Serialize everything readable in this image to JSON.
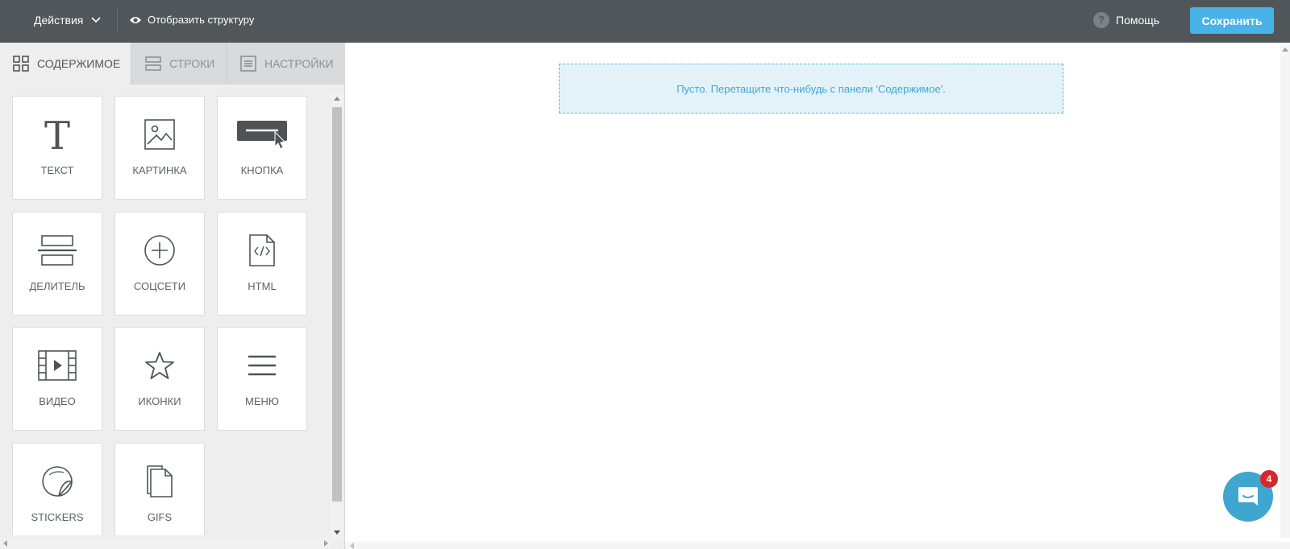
{
  "topbar": {
    "actions_label": "Действия",
    "structure_label": "Отобразить структуру",
    "help_label": "Помощь",
    "save_label": "Сохранить"
  },
  "sidepanel": {
    "tabs": [
      {
        "label": "СОДЕРЖИМОЕ",
        "icon": "grid-icon",
        "active": true
      },
      {
        "label": "СТРОКИ",
        "icon": "rows-icon",
        "active": false
      },
      {
        "label": "НАСТРОЙКИ",
        "icon": "settings-doc-icon",
        "active": false
      }
    ],
    "blocks": [
      {
        "label": "ТЕКСТ",
        "icon": "text-icon"
      },
      {
        "label": "КАРТИНКА",
        "icon": "image-icon"
      },
      {
        "label": "КНОПКА",
        "icon": "button-icon"
      },
      {
        "label": "ДЕЛИТЕЛЬ",
        "icon": "divider-icon"
      },
      {
        "label": "СОЦСЕТИ",
        "icon": "social-plus-icon"
      },
      {
        "label": "HTML",
        "icon": "html-file-icon"
      },
      {
        "label": "ВИДЕО",
        "icon": "video-icon"
      },
      {
        "label": "ИКОНКИ",
        "icon": "star-icon"
      },
      {
        "label": "МЕНЮ",
        "icon": "menu-icon"
      },
      {
        "label": "STICKERS",
        "icon": "sticker-icon"
      },
      {
        "label": "GIFS",
        "icon": "gif-file-icon"
      }
    ]
  },
  "canvas": {
    "empty_message": "Пусто. Перетащите что-нибудь с панели 'Содержимое'."
  },
  "chat": {
    "badge_count": "4"
  },
  "colors": {
    "topbar": "#505659",
    "accent": "#47b3e8",
    "dropzone_bg": "#e3f2f9",
    "badge": "#d8262b"
  }
}
